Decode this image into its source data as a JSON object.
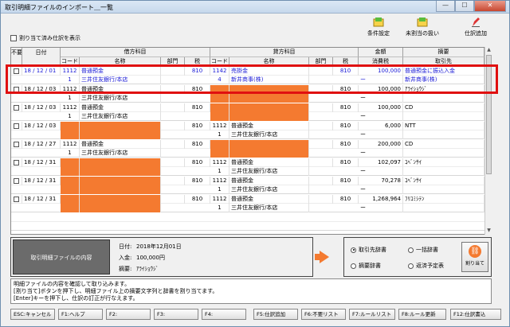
{
  "window": {
    "title": "取引明細ファイルのインポート＿一覧"
  },
  "toolbar": {
    "condition": "条件設定",
    "unassigned": "未割当の扱い",
    "add_entry": "仕訳追加",
    "show_assigned": "割り当て済み仕訳を表示"
  },
  "grid": {
    "headers": {
      "not_needed": "不要",
      "date": "日付",
      "debit": "借方科目",
      "credit": "貸方科目",
      "amount": "金額",
      "summary": "摘要",
      "code": "コード",
      "name": "名称",
      "dept": "部門",
      "tax": "税",
      "tax_amount": "消費税",
      "source": "取引先"
    },
    "rows": [
      {
        "date": "18 / 12 / 01",
        "d_code": "1112",
        "d_name": "普通預金",
        "d_tax": "810",
        "c_code": "1142",
        "c_name": "売掛金",
        "c_tax": "810",
        "amount": "100,000",
        "summary": "普通預金に振込入金",
        "d_code2": "1",
        "d_name2": "三井住友銀行/本店",
        "c_code2": "4",
        "c_name2": "新井商事(株)",
        "tax2": "ー",
        "summary2": "新井商事(株)",
        "blue": true
      },
      {
        "date": "18 / 12 / 03",
        "d_code": "1112",
        "d_name": "普通預金",
        "d_tax": "810",
        "c_code": "",
        "c_name": "",
        "c_tax": "810",
        "amount": "100,000",
        "summary": "ｱﾗｲｼｮｳｼﾞ",
        "d_code2": "1",
        "d_name2": "三井住友銀行/本店",
        "c_code2": "",
        "c_name2": "",
        "tax2": "ー",
        "summary2": "",
        "credit_orange": true
      },
      {
        "date": "18 / 12 / 03",
        "d_code": "1112",
        "d_name": "普通預金",
        "d_tax": "810",
        "c_code": "",
        "c_name": "",
        "c_tax": "810",
        "amount": "100,000",
        "summary": "CD",
        "d_code2": "1",
        "d_name2": "三井住友銀行/本店",
        "c_code2": "",
        "c_name2": "",
        "tax2": "ー",
        "summary2": "",
        "credit_orange": true
      },
      {
        "date": "18 / 12 / 03",
        "d_code": "",
        "d_name": "",
        "d_tax": "810",
        "c_code": "1112",
        "c_name": "普通預金",
        "c_tax": "810",
        "amount": "6,000",
        "summary": "NTT",
        "d_code2": "",
        "d_name2": "",
        "c_code2": "1",
        "c_name2": "三井住友銀行/本店",
        "tax2": "ー",
        "summary2": "",
        "debit_orange": true
      },
      {
        "date": "18 / 12 / 27",
        "d_code": "1112",
        "d_name": "普通預金",
        "d_tax": "810",
        "c_code": "",
        "c_name": "",
        "c_tax": "810",
        "amount": "200,000",
        "summary": "CD",
        "d_code2": "1",
        "d_name2": "三井住友銀行/本店",
        "c_code2": "",
        "c_name2": "",
        "tax2": "ー",
        "summary2": "",
        "credit_orange": true
      },
      {
        "date": "18 / 12 / 31",
        "d_code": "",
        "d_name": "",
        "d_tax": "810",
        "c_code": "1112",
        "c_name": "普通預金",
        "c_tax": "810",
        "amount": "102,097",
        "summary": "ｺﾍﾞﾝｻｲ",
        "d_code2": "",
        "d_name2": "",
        "c_code2": "1",
        "c_name2": "三井住友銀行/本店",
        "tax2": "ー",
        "summary2": "",
        "debit_orange": true
      },
      {
        "date": "18 / 12 / 31",
        "d_code": "",
        "d_name": "",
        "d_tax": "810",
        "c_code": "1112",
        "c_name": "普通預金",
        "c_tax": "810",
        "amount": "70,278",
        "summary": "ｺﾍﾞﾝｻｲ",
        "d_code2": "",
        "d_name2": "",
        "c_code2": "1",
        "c_name2": "三井住友銀行/本店",
        "tax2": "ー",
        "summary2": "",
        "debit_orange": true
      },
      {
        "date": "18 / 12 / 31",
        "d_code": "",
        "d_name": "",
        "d_tax": "810",
        "c_code": "1112",
        "c_name": "普通預金",
        "c_tax": "810",
        "amount": "1,268,964",
        "summary": "ﾌﾘｺﾐｼﾃﾝ",
        "d_code2": "",
        "d_name2": "",
        "c_code2": "1",
        "c_name2": "三井住友銀行/本店",
        "tax2": "ー",
        "summary2": "",
        "debit_orange": true
      },
      {
        "date": "",
        "d_code": "",
        "d_name": "",
        "d_tax": "",
        "c_code": "",
        "c_name": "",
        "c_tax": "",
        "amount": "",
        "summary": "",
        "d_code2": "",
        "d_name2": "",
        "c_code2": "",
        "c_name2": "",
        "tax2": "",
        "summary2": "",
        "partial": true
      }
    ]
  },
  "detail": {
    "label": "取引明細ファイルの内容",
    "date_label": "日付:",
    "date_value": "2018年12月01日",
    "deposit_label": "入金:",
    "deposit_value": "100,000円",
    "summary_label": "摘要:",
    "summary_value": "ｱﾗｲｼｮｳｼﾞ"
  },
  "options": {
    "r1": "取引先辞書",
    "r2": "一括辞書",
    "r3": "摘要辞書",
    "r4": "返済予定表",
    "assign": "割り当て"
  },
  "message": {
    "line1": "明細ファイルの内容を確認して取り込みます。",
    "line2": "[割り当て]ボタンを押下し、明細ファイル上の摘要文字列と辞書を割り当てます。",
    "line3": "[Enter]キーを押下し、仕訳の訂正が行なえます。"
  },
  "fkeys": [
    "ESC:キャンセル",
    "F1:ヘルプ",
    "F2:",
    "F3:",
    "F4:",
    "F5:仕訳追加",
    "F6:不要リスト",
    "F7:ルールリスト",
    "F8:ルール更新",
    "F12:仕訳書込"
  ],
  "colors": {
    "accent": "#f47a30",
    "highlight": "#e01010",
    "link": "#1a1ad6"
  }
}
